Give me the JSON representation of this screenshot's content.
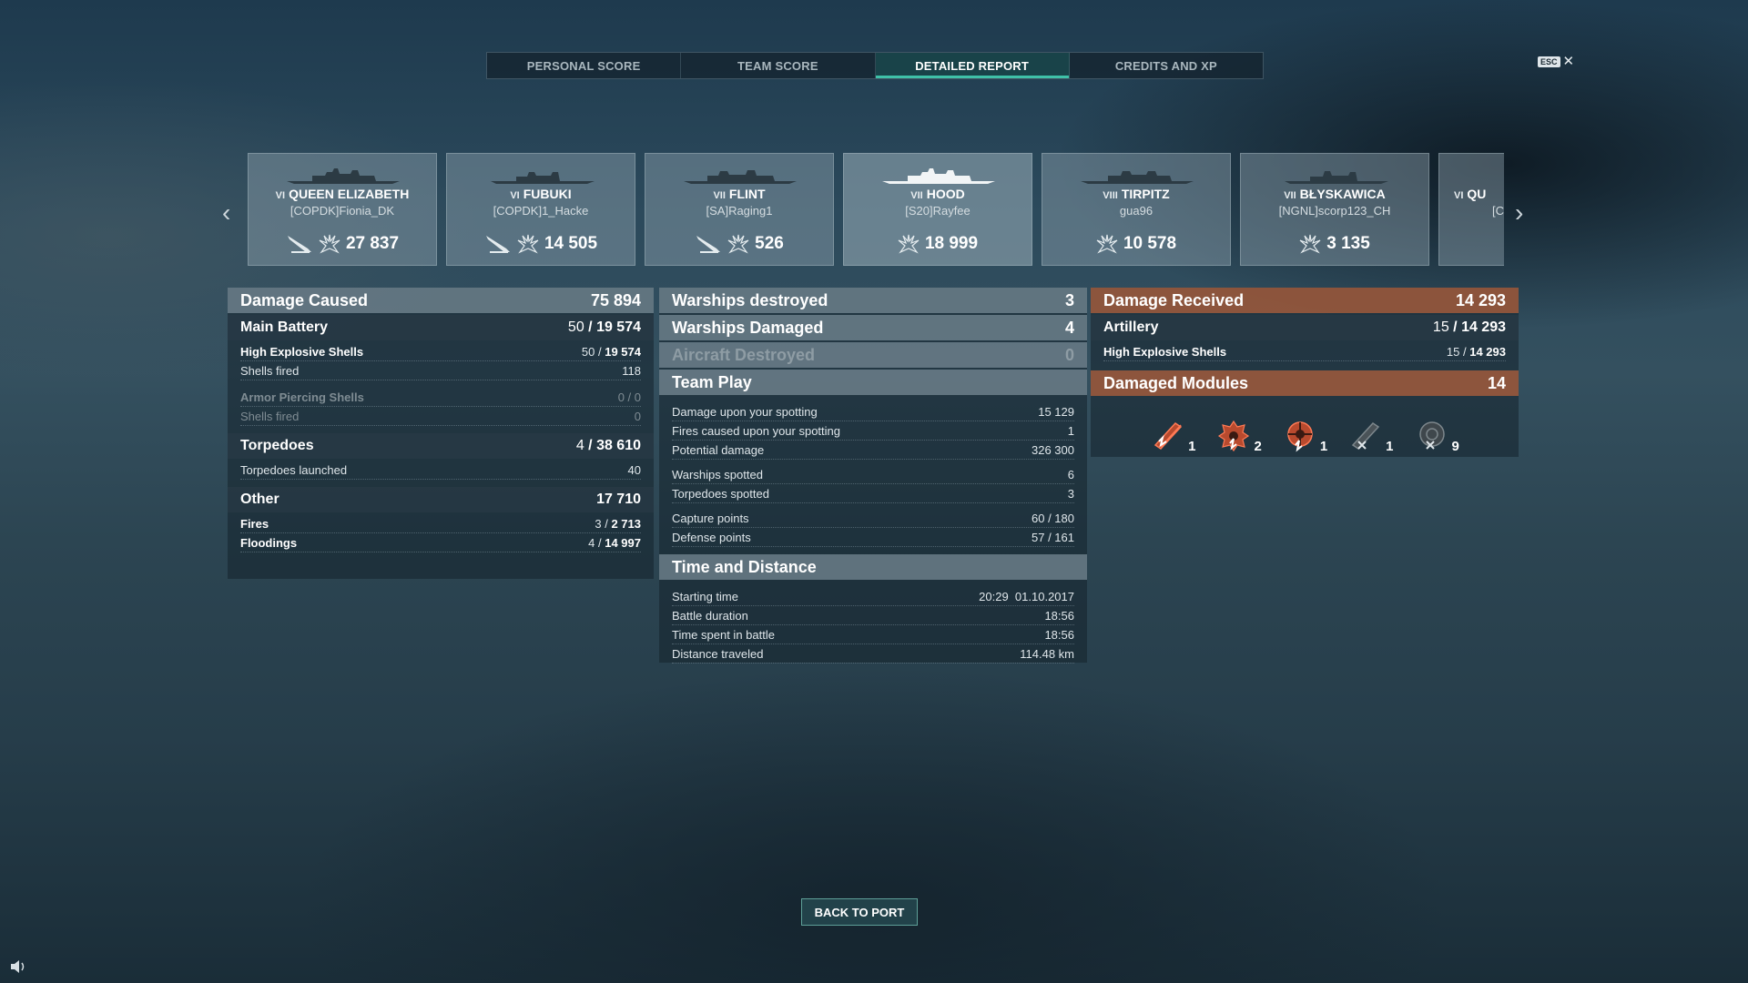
{
  "tabs": [
    "PERSONAL SCORE",
    "TEAM SCORE",
    "DETAILED REPORT",
    "CREDITS AND XP"
  ],
  "active_tab": "DETAILED REPORT",
  "esc": {
    "key": "ESC",
    "close": "✕"
  },
  "carousel": {
    "prev": "‹",
    "next": "›"
  },
  "ships": [
    {
      "tier": "VI",
      "name": "QUEEN ELIZABETH",
      "player": "[COPDK]Fionia_DK",
      "damage": "27 837",
      "torpedo": true
    },
    {
      "tier": "VI",
      "name": "FUBUKI",
      "player": "[COPDK]1_Hacke",
      "damage": "14 505",
      "torpedo": true
    },
    {
      "tier": "VII",
      "name": "FLINT",
      "player": "[SA]Raging1",
      "damage": "526",
      "torpedo": true
    },
    {
      "tier": "VII",
      "name": "HOOD",
      "player": "[S20]Rayfee",
      "damage": "18 999",
      "torpedo": false
    },
    {
      "tier": "VIII",
      "name": "TIRPITZ",
      "player": "gua96",
      "damage": "10 578",
      "torpedo": false
    },
    {
      "tier": "VII",
      "name": "BŁYSKAWICA",
      "player": "[NGNL]scorp123_CH",
      "damage": "3 135",
      "torpedo": false
    },
    {
      "tier": "VI",
      "name": "QU",
      "player": "[C",
      "damage": "",
      "torpedo": false
    }
  ],
  "left": {
    "damage_caused": {
      "label": "Damage Caused",
      "value": "75 894"
    },
    "main_battery": {
      "label": "Main Battery",
      "value_a": "50",
      "value_b": "19 574"
    },
    "he_shells": {
      "label": "High Explosive Shells",
      "value_a": "50",
      "value_b": "19 574"
    },
    "he_fired": {
      "label": "Shells fired",
      "value": "118"
    },
    "ap_shells": {
      "label": "Armor Piercing Shells",
      "value": "0 / 0"
    },
    "ap_fired": {
      "label": "Shells fired",
      "value": "0"
    },
    "torpedoes": {
      "label": "Torpedoes",
      "value_a": "4",
      "value_b": "38 610"
    },
    "torp_launched": {
      "label": "Torpedoes launched",
      "value": "40"
    },
    "other": {
      "label": "Other",
      "value": "17 710"
    },
    "fires": {
      "label": "Fires",
      "value_a": "3",
      "value_b": "2 713"
    },
    "floodings": {
      "label": "Floodings",
      "value_a": "4",
      "value_b": "14 997"
    }
  },
  "middle": {
    "warships_destroyed": {
      "label": "Warships destroyed",
      "value": "3"
    },
    "warships_damaged": {
      "label": "Warships Damaged",
      "value": "4"
    },
    "aircraft_destroyed": {
      "label": "Aircraft Destroyed",
      "value": "0"
    },
    "team_play": {
      "label": "Team Play"
    },
    "dmg_spotting": {
      "label": "Damage upon your spotting",
      "value": "15 129"
    },
    "fires_spotting": {
      "label": "Fires caused upon your spotting",
      "value": "1"
    },
    "potential": {
      "label": "Potential damage",
      "value": "326 300"
    },
    "ships_spotted": {
      "label": "Warships spotted",
      "value": "6"
    },
    "torps_spotted": {
      "label": "Torpedoes spotted",
      "value": "3"
    },
    "capture": {
      "label": "Capture points",
      "value": "60 / 180"
    },
    "defense": {
      "label": "Defense points",
      "value": "57 / 161"
    },
    "time_distance": {
      "label": "Time and Distance"
    },
    "start_time": {
      "label": "Starting time",
      "value": "20:29  01.10.2017"
    },
    "duration": {
      "label": "Battle duration",
      "value": "18:56"
    },
    "time_spent": {
      "label": "Time spent in battle",
      "value": "18:56"
    },
    "distance": {
      "label": "Distance traveled",
      "value": "114.48 km"
    }
  },
  "right": {
    "damage_received": {
      "label": "Damage Received",
      "value": "14 293"
    },
    "artillery": {
      "label": "Artillery",
      "value_a": "15",
      "value_b": "14 293"
    },
    "he_shells": {
      "label": "High Explosive Shells",
      "value_a": "15",
      "value_b": "14 293"
    },
    "damaged_modules": {
      "label": "Damaged Modules",
      "value": "14"
    },
    "modules": [
      {
        "icon": "main-gun-damaged-icon",
        "count": "1"
      },
      {
        "icon": "engine-damaged-icon",
        "count": "2"
      },
      {
        "icon": "steering-damaged-icon",
        "count": "1"
      },
      {
        "icon": "gun-destroyed-icon",
        "count": "1"
      },
      {
        "icon": "aa-destroyed-icon",
        "count": "9"
      }
    ]
  },
  "back_to_port": "BACK TO PORT",
  "colors": {
    "accent": "#3fc1a8",
    "brown": "#a05a3c"
  }
}
